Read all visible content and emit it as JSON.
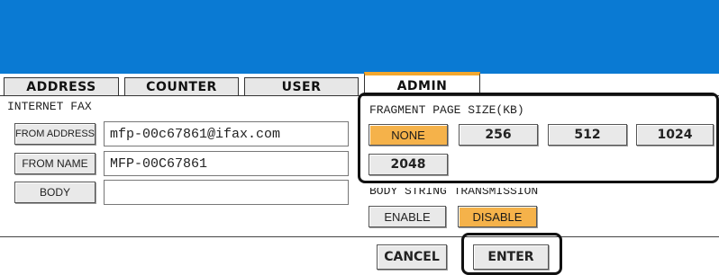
{
  "tabs": [
    {
      "label": "ADDRESS"
    },
    {
      "label": "COUNTER"
    },
    {
      "label": "USER"
    },
    {
      "label": "ADMIN"
    }
  ],
  "active_tab": "ADMIN",
  "internet_fax": {
    "section_label": "INTERNET FAX",
    "from_address": {
      "button_label": "FROM ADDRESS",
      "value": "mfp-00c67861@ifax.com"
    },
    "from_name": {
      "button_label": "FROM NAME",
      "value": "MFP-00C67861"
    },
    "body": {
      "button_label": "BODY",
      "value": ""
    }
  },
  "fragment_page_size": {
    "section_label": "FRAGMENT PAGE SIZE(KB)",
    "options": [
      "NONE",
      "256",
      "512",
      "1024",
      "2048"
    ],
    "selected": "NONE"
  },
  "body_string_transmission": {
    "section_label": "BODY STRING TRANSMISSION",
    "options": [
      "ENABLE",
      "DISABLE"
    ],
    "selected": "DISABLE"
  },
  "footer": {
    "cancel_label": "CANCEL",
    "enter_label": "ENTER"
  },
  "colors": {
    "header_blue": "#0a7ad3",
    "selected_orange": "#f5b24a",
    "tab_accent": "#f3a72e"
  }
}
